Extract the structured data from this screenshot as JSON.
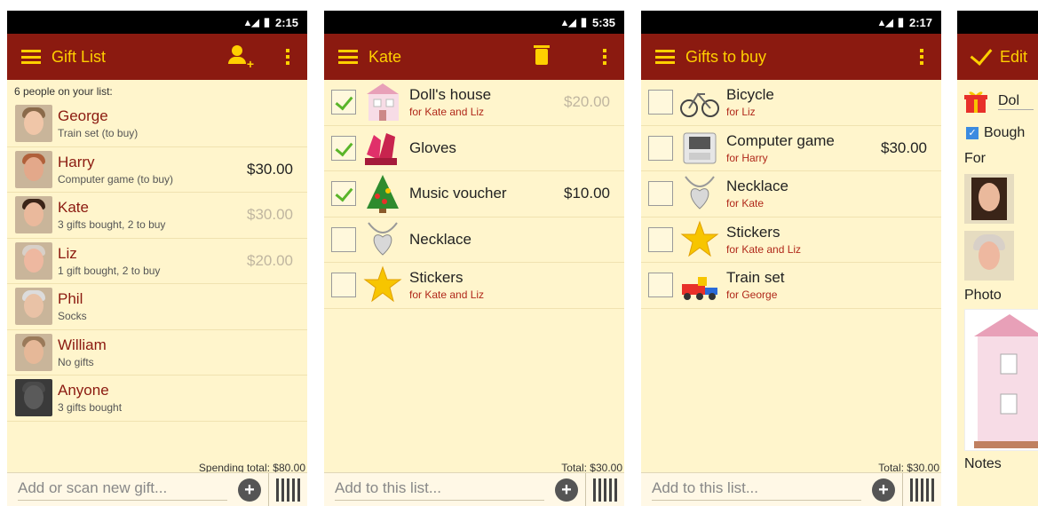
{
  "status": [
    "2:15",
    "5:35",
    "2:17"
  ],
  "screen1": {
    "title": "Gift List",
    "subheader": "6 people on your list:",
    "people": [
      {
        "name": "George",
        "sub": "Train set (to buy)",
        "price": "",
        "faded": false,
        "skin": "#f0c6a8",
        "hair": "#8a6a4a"
      },
      {
        "name": "Harry",
        "sub": "Computer game (to buy)",
        "price": "$30.00",
        "faded": false,
        "skin": "#e3a88a",
        "hair": "#b0603a"
      },
      {
        "name": "Kate",
        "sub": "3 gifts bought, 2 to buy",
        "price": "$30.00",
        "faded": true,
        "skin": "#eab99c",
        "hair": "#3a2418"
      },
      {
        "name": "Liz",
        "sub": "1 gift bought, 2 to buy",
        "price": "$20.00",
        "faded": true,
        "skin": "#eeb8a0",
        "hair": "#d8d0c8"
      },
      {
        "name": "Phil",
        "sub": "Socks",
        "price": "",
        "faded": false,
        "skin": "#e9c2a6",
        "hair": "#dcdcdc"
      },
      {
        "name": "William",
        "sub": "No gifts",
        "price": "",
        "faded": false,
        "skin": "#e6b898",
        "hair": "#9a7a5a"
      },
      {
        "name": "Anyone",
        "sub": "3 gifts bought",
        "price": "",
        "faded": false,
        "skin": "#5a5a5a",
        "hair": "#4a4a4a"
      }
    ],
    "total": "Spending total: $80.00",
    "placeholder": "Add or scan new gift..."
  },
  "screen2": {
    "title": "Kate",
    "gifts": [
      {
        "name": "Doll's house",
        "sub": "for Kate and Liz",
        "price": "$20.00",
        "faded": true,
        "checked": true,
        "icon": "dollhouse-icon"
      },
      {
        "name": "Gloves",
        "sub": "",
        "price": "",
        "faded": false,
        "checked": true,
        "icon": "gloves-icon"
      },
      {
        "name": "Music voucher",
        "sub": "",
        "price": "$10.00",
        "faded": false,
        "checked": true,
        "icon": "tree-icon"
      },
      {
        "name": "Necklace",
        "sub": "",
        "price": "",
        "faded": false,
        "checked": false,
        "icon": "necklace-icon"
      },
      {
        "name": "Stickers",
        "sub": "for Kate and Liz",
        "price": "",
        "faded": false,
        "checked": false,
        "icon": "star-icon"
      }
    ],
    "total": "Total: $30.00",
    "placeholder": "Add to this list..."
  },
  "screen3": {
    "title": "Gifts to buy",
    "gifts": [
      {
        "name": "Bicycle",
        "sub": "for Liz",
        "price": "",
        "icon": "bicycle-icon"
      },
      {
        "name": "Computer game",
        "sub": "for Harry",
        "price": "$30.00",
        "icon": "handheld-icon"
      },
      {
        "name": "Necklace",
        "sub": "for Kate",
        "price": "",
        "icon": "necklace-icon"
      },
      {
        "name": "Stickers",
        "sub": "for Kate and Liz",
        "price": "",
        "icon": "star-icon"
      },
      {
        "name": "Train set",
        "sub": "for George",
        "price": "",
        "icon": "train-icon"
      }
    ],
    "total": "Total: $30.00",
    "placeholder": "Add to this list..."
  },
  "screen4": {
    "title": "Edit",
    "gift_name": "Dol",
    "bought_label": "Bough",
    "for_label": "For",
    "photo_label": "Photo",
    "notes_label": "Notes"
  }
}
